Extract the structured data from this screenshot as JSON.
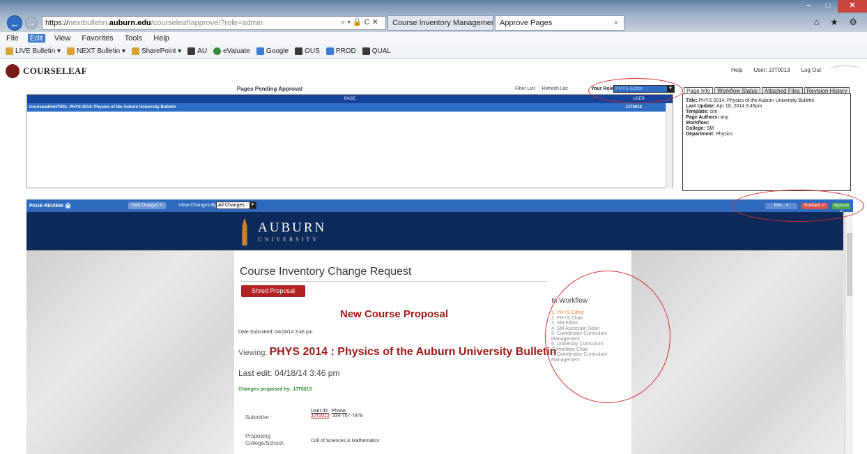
{
  "browser": {
    "address": {
      "prefix": "https://",
      "host_pre": "nextbulletin.",
      "host": "auburn.edu",
      "path": "/courseleaf/approve/?role=admin",
      "controls": "⌕ ▾ 🔒 C ✕"
    },
    "tabs": [
      {
        "label": "Course Inventory Management"
      },
      {
        "label": "Approve Pages",
        "close": "×"
      }
    ],
    "window_controls": {
      "minimize": "–",
      "maximize": "□",
      "close": "✕"
    },
    "right_icons": "⌂ ★ ⚙",
    "menu": [
      "File",
      "Edit",
      "View",
      "Favorites",
      "Tools",
      "Help"
    ],
    "favorites": [
      {
        "label": "LIVE Bulletin ▾",
        "color": "#d8a235"
      },
      {
        "label": "NEXT Bulletin ▾",
        "color": "#d8a235"
      },
      {
        "label": "SharePoint ▾",
        "color": "#d8a235"
      },
      {
        "label": "AU",
        "color": "#3a3a3a"
      },
      {
        "label": "eValuate",
        "color": "#3b8a3b"
      },
      {
        "label": "Google",
        "color": "#3a7fd5"
      },
      {
        "label": "OUS",
        "color": "#3a3a3a"
      },
      {
        "label": "PROD",
        "color": "#3a7fd5"
      },
      {
        "label": "QUAL",
        "color": "#3a3a3a"
      }
    ]
  },
  "courseleaf": {
    "logo": "COURSELEAF",
    "header_links": {
      "help": "Help",
      "user": "User: JJT0013",
      "logout": "Log Out"
    }
  },
  "pending": {
    "title": "Pages Pending Approval",
    "filter": "Filter List",
    "refresh": "Refresh List",
    "role_label": "Your Role:",
    "role_value": "PHYS Editor",
    "col_page": "PAGE",
    "col_user": "USER",
    "row_page": "/courseadmin/7001: PHYS 2014: Physics of the Auburn University Bulletin",
    "row_user": "JJT0013"
  },
  "info": {
    "tabs": [
      "Page Info",
      "Workflow Status",
      "Attached Files",
      "Revision History"
    ],
    "lines": [
      {
        "k": "Title:",
        "v": "PHYS 2014: Physics of the Auburn University Bulletin"
      },
      {
        "k": "Last Update:",
        "v": "Apr 18, 2014 3:45pm"
      },
      {
        "k": "Template:",
        "v": "cim"
      },
      {
        "k": "Page Authors:",
        "v": "any"
      },
      {
        "k": "Workflow:",
        "v": ""
      },
      {
        "k": "College:",
        "v": "SM"
      },
      {
        "k": "Department:",
        "v": "Physics"
      }
    ]
  },
  "review": {
    "label": "PAGE REVIEW 🖨",
    "hide_changes": "Hide Changes ✎",
    "view_by_label": "View Changes By:",
    "view_by_value": "All Changes",
    "edit": "Edit... ▾",
    "rollback": "Rollback ↺",
    "approve": "Approve ✔"
  },
  "document": {
    "auburn": "AUBURN",
    "university": "UNIVERSITY",
    "title": "Course Inventory Change Request",
    "shred": "Shred Proposal",
    "heading": "New Course Proposal",
    "date": "Date Submitted: 04/18/14 3:46 pm",
    "viewing_prefix": "Viewing:",
    "viewing_course": "PHYS 2014 : Physics of the Auburn University Bulletin",
    "last_edit": "Last edit: 04/18/14 3:46 pm",
    "changes_by": "Changes proposed by: JJT0013",
    "submitter_label": "Submitter:",
    "user_id_label": "User ID:",
    "phone_label": "Phone:",
    "user_id": "JJT0013",
    "phone": "334-707-7878",
    "college_label": "Proposing College/School:",
    "college_value": "Coll of Sciences & Mathematics",
    "workflow_title": "In Workflow",
    "workflow": [
      "1. PHYS Editor",
      "2. PHYS Chair",
      "3. SM Editor",
      "4. SM Associate Dean",
      "5. Coordinator Curriculum Management",
      "6. University Curriculum Committee Chair",
      "7. Coordinator Curriculum Management"
    ]
  },
  "colors": {
    "accent": "#2e6bbf",
    "auburn_navy": "#0d2a5a",
    "auburn_red": "#a11818",
    "annotation": "#d42a2a"
  }
}
